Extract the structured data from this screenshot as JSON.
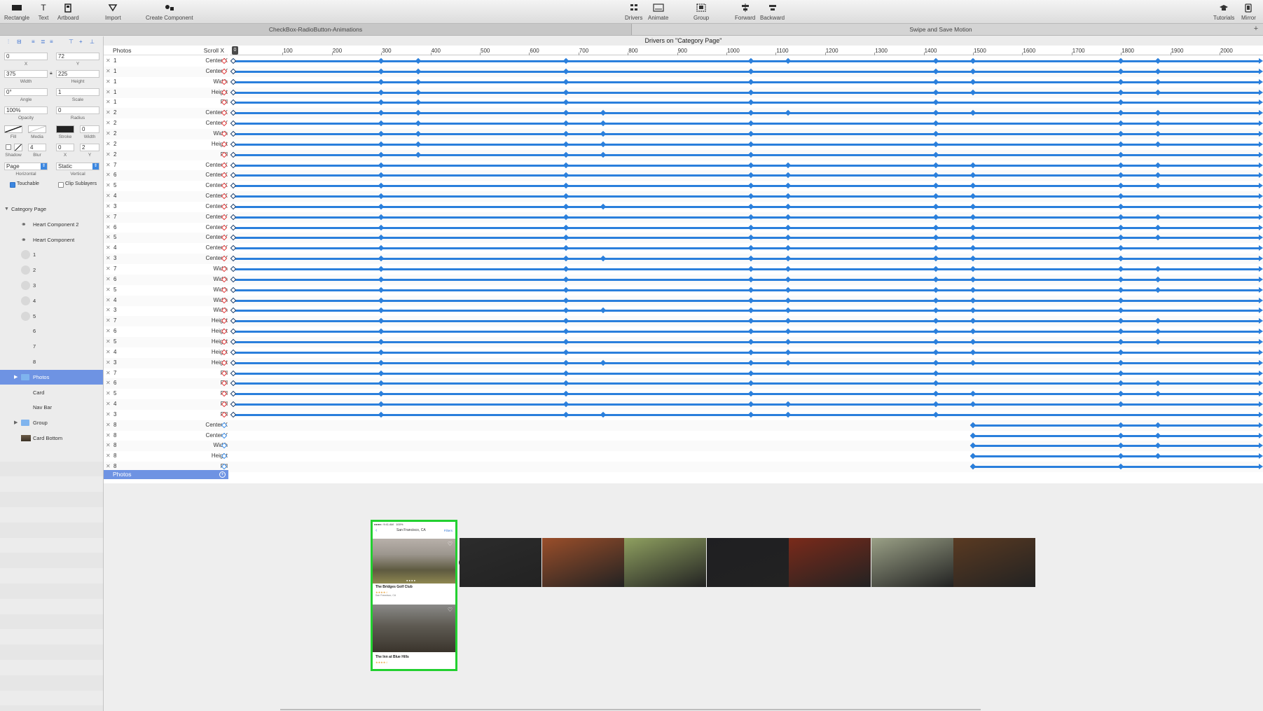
{
  "toolbar": {
    "left": [
      {
        "label": "Rectangle",
        "icon": "rectangle-icon"
      },
      {
        "label": "Text",
        "icon": "text-icon"
      },
      {
        "label": "Artboard",
        "icon": "artboard-icon"
      },
      {
        "label": "Import",
        "icon": "import-icon"
      },
      {
        "label": "Create Component",
        "icon": "component-icon"
      }
    ],
    "center": [
      {
        "label": "Drivers",
        "icon": "drivers-icon"
      },
      {
        "label": "Animate",
        "icon": "animate-icon"
      },
      {
        "label": "Group",
        "icon": "group-icon"
      },
      {
        "label": "Forward",
        "icon": "forward-icon"
      },
      {
        "label": "Backward",
        "icon": "backward-icon"
      }
    ],
    "right": [
      {
        "label": "Tutorials",
        "icon": "tutorials-icon"
      },
      {
        "label": "Mirror",
        "icon": "mirror-icon"
      }
    ]
  },
  "tabs": [
    "CheckBox-RadioButton-Animations",
    "Swipe and Save Motion"
  ],
  "inspector": {
    "x": "0",
    "y": "72",
    "x_label": "X",
    "y_label": "Y",
    "width": "375",
    "height": "225",
    "width_label": "Width",
    "height_label": "Height",
    "angle": "0°",
    "scale": "1",
    "angle_label": "Angle",
    "scale_label": "Scale",
    "opacity": "100%",
    "radius": "0",
    "opacity_label": "Opacity",
    "radius_label": "Radius",
    "fill_label": "Fill",
    "media_label": "Media",
    "stroke_label": "Stroke",
    "stroke_width": "0",
    "stroke_width_label": "Width",
    "shadow_label": "Shadow",
    "blur": "4",
    "blur_label": "Blur",
    "shadow_x": "0",
    "shadow_y": "2",
    "shadow_x_label": "X",
    "shadow_y_label": "Y",
    "horizontal": "Page",
    "vertical": "Static",
    "horizontal_label": "Horizontal",
    "vertical_label": "Vertical",
    "touchable": "Touchable",
    "clip_sublayers": "Clip Sublayers"
  },
  "layers": [
    {
      "name": "Category Page",
      "indent": 0,
      "icon": "disclosure-open-icon"
    },
    {
      "name": "Heart Component 2",
      "indent": 1,
      "icon": "component-icon"
    },
    {
      "name": "Heart Component",
      "indent": 1,
      "icon": "component-icon"
    },
    {
      "name": "1",
      "indent": 1,
      "icon": "circle-icon"
    },
    {
      "name": "2",
      "indent": 1,
      "icon": "circle-icon"
    },
    {
      "name": "3",
      "indent": 1,
      "icon": "circle-icon"
    },
    {
      "name": "4",
      "indent": 1,
      "icon": "circle-icon"
    },
    {
      "name": "5",
      "indent": 1,
      "icon": "circle-icon"
    },
    {
      "name": "6",
      "indent": 1,
      "icon": ""
    },
    {
      "name": "7",
      "indent": 1,
      "icon": ""
    },
    {
      "name": "8",
      "indent": 1,
      "icon": ""
    },
    {
      "name": "Photos",
      "indent": 1,
      "icon": "folder-icon",
      "selected": true
    },
    {
      "name": "Card",
      "indent": 1,
      "icon": ""
    },
    {
      "name": "Nav Bar",
      "indent": 1,
      "icon": ""
    },
    {
      "name": "Group",
      "indent": 1,
      "icon": "folder-icon"
    },
    {
      "name": "Card Bottom",
      "indent": 1,
      "icon": "image-icon"
    }
  ],
  "drivers": {
    "title": "Drivers on \"Category Page\"",
    "source_header": "Photos",
    "driver_header": "Scroll X",
    "playhead": "0",
    "ruler": [
      "100",
      "200",
      "300",
      "400",
      "500",
      "600",
      "700",
      "800",
      "900",
      "1000",
      "1100",
      "1200",
      "1300",
      "1400",
      "1500",
      "1600",
      "1700",
      "1800",
      "1900",
      "2000"
    ],
    "rows": [
      {
        "obj": "1",
        "prop": "Center X",
        "kf": [
          300,
          375,
          675,
          1050,
          1125,
          1425,
          1500,
          1800,
          1875
        ]
      },
      {
        "obj": "1",
        "prop": "Center Y",
        "kf": [
          300,
          375,
          675,
          1050,
          1425,
          1500,
          1800,
          1875
        ]
      },
      {
        "obj": "1",
        "prop": "Width",
        "kf": [
          300,
          375,
          675,
          1050,
          1425,
          1500,
          1800,
          1875
        ]
      },
      {
        "obj": "1",
        "prop": "Height",
        "kf": [
          300,
          375,
          675,
          1050,
          1425,
          1500,
          1800,
          1875
        ]
      },
      {
        "obj": "1",
        "prop": "Fill",
        "kf": [
          300,
          375,
          675,
          1050,
          1425,
          1800
        ]
      },
      {
        "obj": "2",
        "prop": "Center X",
        "kf": [
          300,
          375,
          675,
          750,
          1050,
          1125,
          1425,
          1500,
          1800,
          1875
        ]
      },
      {
        "obj": "2",
        "prop": "Center Y",
        "kf": [
          300,
          375,
          675,
          750,
          1050,
          1425,
          1800,
          1875
        ]
      },
      {
        "obj": "2",
        "prop": "Width",
        "kf": [
          300,
          375,
          675,
          750,
          1050,
          1425,
          1800,
          1875
        ]
      },
      {
        "obj": "2",
        "prop": "Height",
        "kf": [
          300,
          375,
          675,
          750,
          1050,
          1425,
          1800,
          1875
        ]
      },
      {
        "obj": "2",
        "prop": "Fill",
        "kf": [
          300,
          375,
          675,
          750,
          1050,
          1425,
          1800
        ]
      },
      {
        "obj": "7",
        "prop": "Center X",
        "kf": [
          300,
          675,
          1050,
          1125,
          1425,
          1500,
          1800,
          1875
        ]
      },
      {
        "obj": "6",
        "prop": "Center X",
        "kf": [
          300,
          675,
          1050,
          1125,
          1425,
          1500,
          1800,
          1875
        ]
      },
      {
        "obj": "5",
        "prop": "Center X",
        "kf": [
          300,
          675,
          1050,
          1125,
          1425,
          1500,
          1800,
          1875
        ]
      },
      {
        "obj": "4",
        "prop": "Center X",
        "kf": [
          300,
          675,
          1050,
          1125,
          1425,
          1500,
          1800
        ]
      },
      {
        "obj": "3",
        "prop": "Center X",
        "kf": [
          300,
          675,
          750,
          1050,
          1125,
          1425,
          1500,
          1800
        ]
      },
      {
        "obj": "7",
        "prop": "Center Y",
        "kf": [
          300,
          675,
          1050,
          1125,
          1425,
          1500,
          1800,
          1875
        ]
      },
      {
        "obj": "6",
        "prop": "Center Y",
        "kf": [
          300,
          675,
          1050,
          1125,
          1425,
          1500,
          1800,
          1875
        ]
      },
      {
        "obj": "5",
        "prop": "Center Y",
        "kf": [
          300,
          675,
          1050,
          1125,
          1425,
          1500,
          1800,
          1875
        ]
      },
      {
        "obj": "4",
        "prop": "Center Y",
        "kf": [
          300,
          675,
          1050,
          1125,
          1425,
          1500,
          1800
        ]
      },
      {
        "obj": "3",
        "prop": "Center Y",
        "kf": [
          300,
          675,
          750,
          1050,
          1125,
          1425,
          1500,
          1800
        ]
      },
      {
        "obj": "7",
        "prop": "Width",
        "kf": [
          300,
          675,
          1050,
          1125,
          1425,
          1500,
          1800,
          1875
        ]
      },
      {
        "obj": "6",
        "prop": "Width",
        "kf": [
          300,
          675,
          1050,
          1125,
          1425,
          1500,
          1800,
          1875
        ]
      },
      {
        "obj": "5",
        "prop": "Width",
        "kf": [
          300,
          675,
          1050,
          1125,
          1425,
          1500,
          1800,
          1875
        ]
      },
      {
        "obj": "4",
        "prop": "Width",
        "kf": [
          300,
          675,
          1050,
          1125,
          1425,
          1500,
          1800
        ]
      },
      {
        "obj": "3",
        "prop": "Width",
        "kf": [
          300,
          675,
          750,
          1050,
          1125,
          1425,
          1500,
          1800
        ]
      },
      {
        "obj": "7",
        "prop": "Height",
        "kf": [
          300,
          675,
          1050,
          1125,
          1425,
          1500,
          1800,
          1875
        ]
      },
      {
        "obj": "6",
        "prop": "Height",
        "kf": [
          300,
          675,
          1050,
          1125,
          1425,
          1500,
          1800,
          1875
        ]
      },
      {
        "obj": "5",
        "prop": "Height",
        "kf": [
          300,
          675,
          1050,
          1125,
          1425,
          1500,
          1800,
          1875
        ]
      },
      {
        "obj": "4",
        "prop": "Height",
        "kf": [
          300,
          675,
          1050,
          1125,
          1425,
          1500,
          1800
        ]
      },
      {
        "obj": "3",
        "prop": "Height",
        "kf": [
          300,
          675,
          750,
          1050,
          1125,
          1425,
          1500,
          1800
        ]
      },
      {
        "obj": "7",
        "prop": "Fill",
        "kf": [
          300,
          675,
          1050,
          1425,
          1800
        ]
      },
      {
        "obj": "6",
        "prop": "Fill",
        "kf": [
          300,
          675,
          1050,
          1425,
          1800,
          1875
        ]
      },
      {
        "obj": "5",
        "prop": "Fill",
        "kf": [
          300,
          675,
          1050,
          1425,
          1500,
          1800,
          1875
        ]
      },
      {
        "obj": "4",
        "prop": "Fill",
        "kf": [
          300,
          675,
          1050,
          1125,
          1425,
          1500,
          1800
        ]
      },
      {
        "obj": "3",
        "prop": "Fill",
        "kf": [
          300,
          675,
          750,
          1050,
          1125,
          1425
        ]
      },
      {
        "obj": "8",
        "prop": "Center X",
        "kf": [
          1500,
          1800,
          1875
        ],
        "start": 1500,
        "blue": true
      },
      {
        "obj": "8",
        "prop": "Center Y",
        "kf": [
          1500,
          1800,
          1875
        ],
        "start": 1500,
        "blue": true
      },
      {
        "obj": "8",
        "prop": "Width",
        "kf": [
          1500,
          1800,
          1875
        ],
        "start": 1500,
        "blue": true
      },
      {
        "obj": "8",
        "prop": "Height",
        "kf": [
          1500,
          1800,
          1875
        ],
        "start": 1500,
        "blue": true
      },
      {
        "obj": "8",
        "prop": "Fill",
        "kf": [
          1500,
          1800
        ],
        "start": 1500,
        "blue": true
      }
    ],
    "add_row_label": "Photos"
  },
  "card": {
    "location": "San Francisco, CA",
    "filters": "Filters",
    "venue1": "The Bridges Golf Club",
    "venue1_meta": "San Francisco, CA",
    "venue2": "The Inn at Blue Hills"
  },
  "photo_colors": [
    "#2c2c2c",
    "#9a4e2a",
    "#8fa060",
    "#1f1f22",
    "#7a2a1a",
    "#9aa086",
    "#5a3a22"
  ],
  "accent": "#2a7fdc",
  "selection": "#6e93e3",
  "phone_border": "#22d030"
}
